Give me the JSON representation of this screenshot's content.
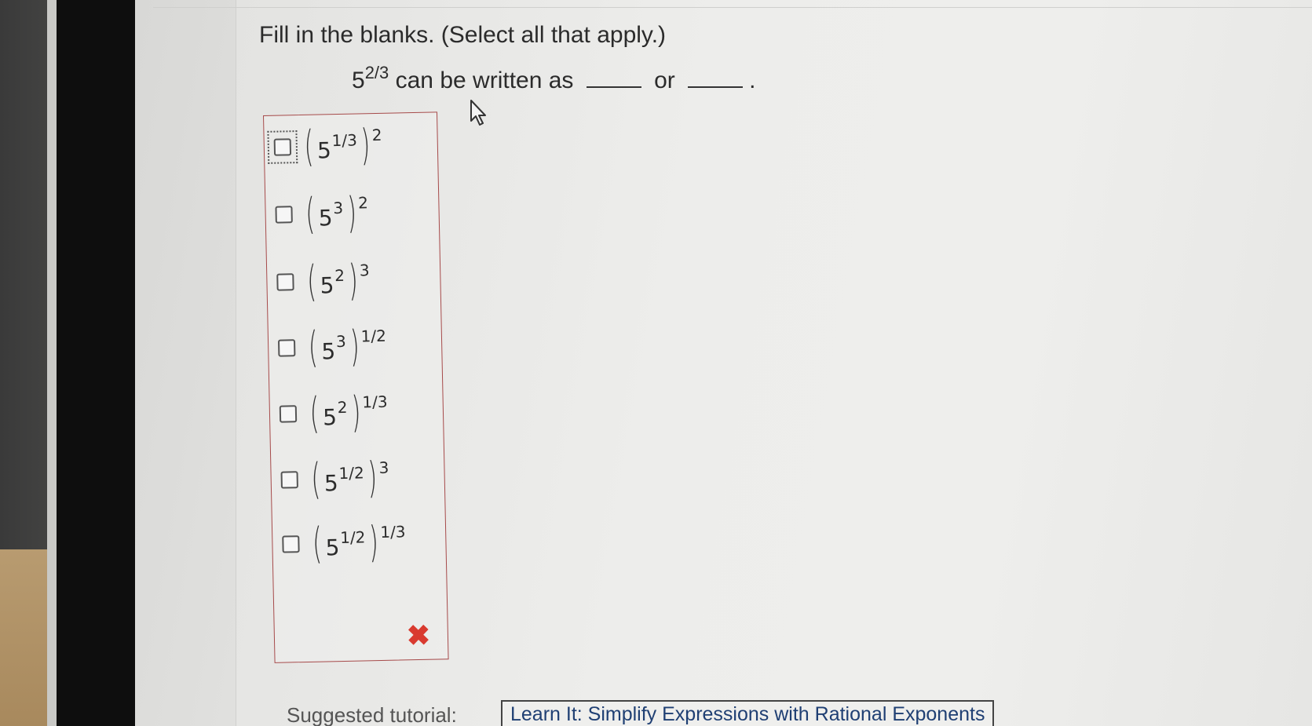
{
  "instructions": "Fill in the blanks. (Select all that apply.)",
  "question": {
    "base": "5",
    "exponent": "2/3",
    "text": "can be written as",
    "connector": "or",
    "end": "."
  },
  "options": [
    {
      "inner_base": "5",
      "inner_exp": "1/3",
      "outer_exp": "2"
    },
    {
      "inner_base": "5",
      "inner_exp": "3",
      "outer_exp": "2"
    },
    {
      "inner_base": "5",
      "inner_exp": "2",
      "outer_exp": "3"
    },
    {
      "inner_base": "5",
      "inner_exp": "3",
      "outer_exp": "1/2"
    },
    {
      "inner_base": "5",
      "inner_exp": "2",
      "outer_exp": "1/3"
    },
    {
      "inner_base": "5",
      "inner_exp": "1/2",
      "outer_exp": "3"
    },
    {
      "inner_base": "5",
      "inner_exp": "1/2",
      "outer_exp": "1/3"
    }
  ],
  "result_icon": "incorrect-x-icon",
  "tutorial": {
    "label": "Suggested tutorial:",
    "link": "Learn It: Simplify Expressions with Rational Exponents"
  },
  "colors": {
    "incorrect": "#d93a2f",
    "box_border": "#a64a4a",
    "link": "#1f3f73"
  }
}
